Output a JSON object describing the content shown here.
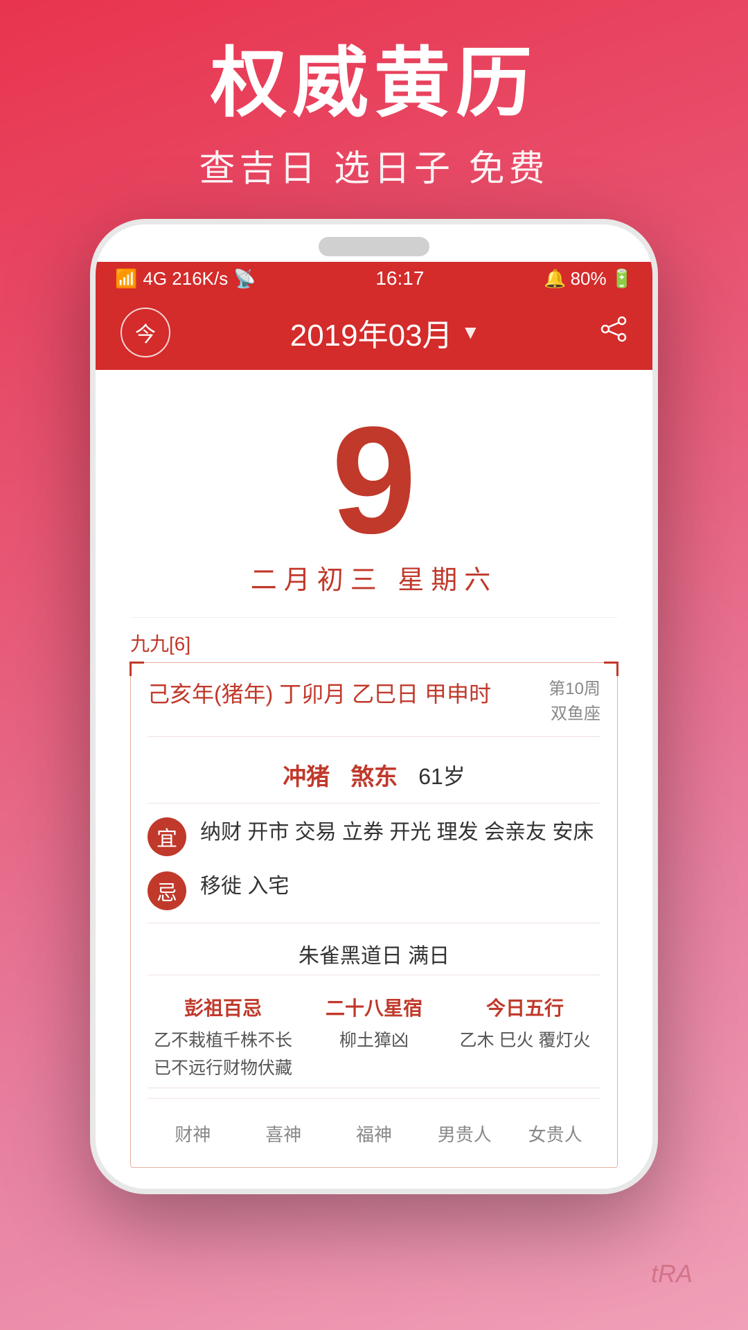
{
  "background": {
    "gradient_start": "#e8344e",
    "gradient_end": "#f0a0b8"
  },
  "top": {
    "main_title": "权威黄历",
    "sub_title": "查吉日 选日子 免费"
  },
  "status_bar": {
    "signal": "4G  216K/s",
    "wifi": "wifi",
    "time": "16:17",
    "alarm": "alarm",
    "battery": "80%"
  },
  "app_header": {
    "today_label": "今",
    "month_display": "2019年03月",
    "arrow": "▼"
  },
  "calendar": {
    "big_day": "9",
    "lunar_info": "二月初三  星期六",
    "nine_nine": "九九[6]",
    "ganzhi": "己亥年(猪年) 丁卯月 乙巳日 甲申时",
    "week_info": "第10周",
    "zodiac": "双鱼座",
    "chong": "冲猪",
    "sha": "煞东",
    "age": "61岁",
    "yi_label": "宜",
    "yi_content": "纳财 开市 交易 立券 开光 理发 会亲友\n安床",
    "ji_label": "忌",
    "ji_content": "移徙 入宅",
    "zhuri": "朱雀黑道日  满日",
    "col1_title": "彭祖百忌",
    "col1_content": "乙不栽植千株不长\n已不远行财物伏藏",
    "col2_title": "二十八星宿",
    "col2_content": "柳土獐凶",
    "col3_title": "今日五行",
    "col3_content": "乙木 巳火 覆灯火",
    "footer_items": [
      "财神",
      "喜神",
      "福神",
      "男贵人",
      "女贵人"
    ],
    "watermark": "tRA"
  }
}
